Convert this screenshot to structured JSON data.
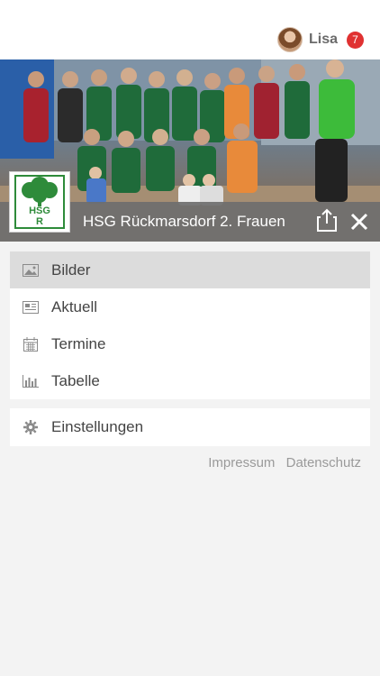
{
  "user": {
    "name": "Lisa",
    "badge_count": "7"
  },
  "team": {
    "title": "HSG Rückmarsdorf 2. Frauen",
    "logo_text_top": "HSG",
    "logo_text_bottom": "R"
  },
  "menu": {
    "items": [
      {
        "label": "Bilder",
        "icon": "image-icon",
        "active": true
      },
      {
        "label": "Aktuell",
        "icon": "news-icon",
        "active": false
      },
      {
        "label": "Termine",
        "icon": "calendar-icon",
        "active": false
      },
      {
        "label": "Tabelle",
        "icon": "bar-chart-icon",
        "active": false
      }
    ],
    "settings_label": "Einstellungen"
  },
  "footer": {
    "impressum": "Impressum",
    "datenschutz": "Datenschutz"
  },
  "colors": {
    "accent_green": "#2e8b3a",
    "badge_red": "#e03131",
    "bar_gray": "#6e6e6e"
  }
}
